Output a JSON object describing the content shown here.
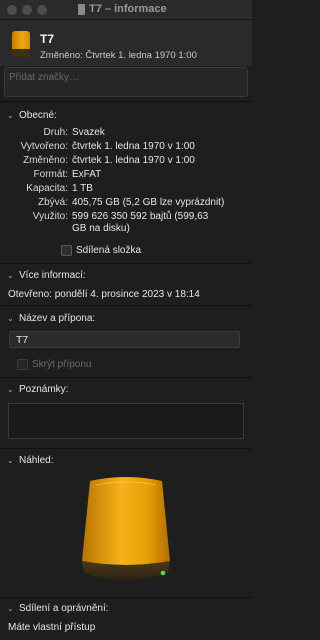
{
  "window": {
    "title": "T7 – informace"
  },
  "header": {
    "name": "T7",
    "modified": "Změněno: Čtvrtek 1. ledna 1970 1:00"
  },
  "tags": {
    "placeholder": "Přidat značky…"
  },
  "general": {
    "label": "Obecné:",
    "rows": [
      {
        "key": "Druh:",
        "value": "Svazek"
      },
      {
        "key": "Vytvořeno:",
        "value": "čtvrtek 1. ledna 1970 v 1:00"
      },
      {
        "key": "Změněno:",
        "value": "čtvrtek 1. ledna 1970 v 1:00"
      },
      {
        "key": "Formát:",
        "value": "ExFAT"
      },
      {
        "key": "Kapacita:",
        "value": "1 TB"
      },
      {
        "key": "Zbývá:",
        "value": "405,75 GB (5,2 GB lze vyprázdnit)"
      },
      {
        "key": "Využito:",
        "value_line1": "599 626 350 592 bajtů (599,63",
        "value_line2": "GB na disku)"
      }
    ],
    "shared_folder": "Sdílená složka"
  },
  "more_info": {
    "label": "Více informací:",
    "opened": "Otevřeno: pondělí 4. prosince 2023 v 18:14"
  },
  "name_ext": {
    "label": "Název a přípona:",
    "value": "T7",
    "hide_ext": "Skrýt příponu"
  },
  "comments": {
    "label": "Poznámky:"
  },
  "preview": {
    "label": "Náhled:"
  },
  "sharing": {
    "label": "Sdílení a oprávnění:",
    "access": "Máte vlastní přístup"
  },
  "colors": {
    "drive_orange": "#f0a70c",
    "drive_dark": "#3d2f17",
    "led_green": "#4cd964"
  }
}
